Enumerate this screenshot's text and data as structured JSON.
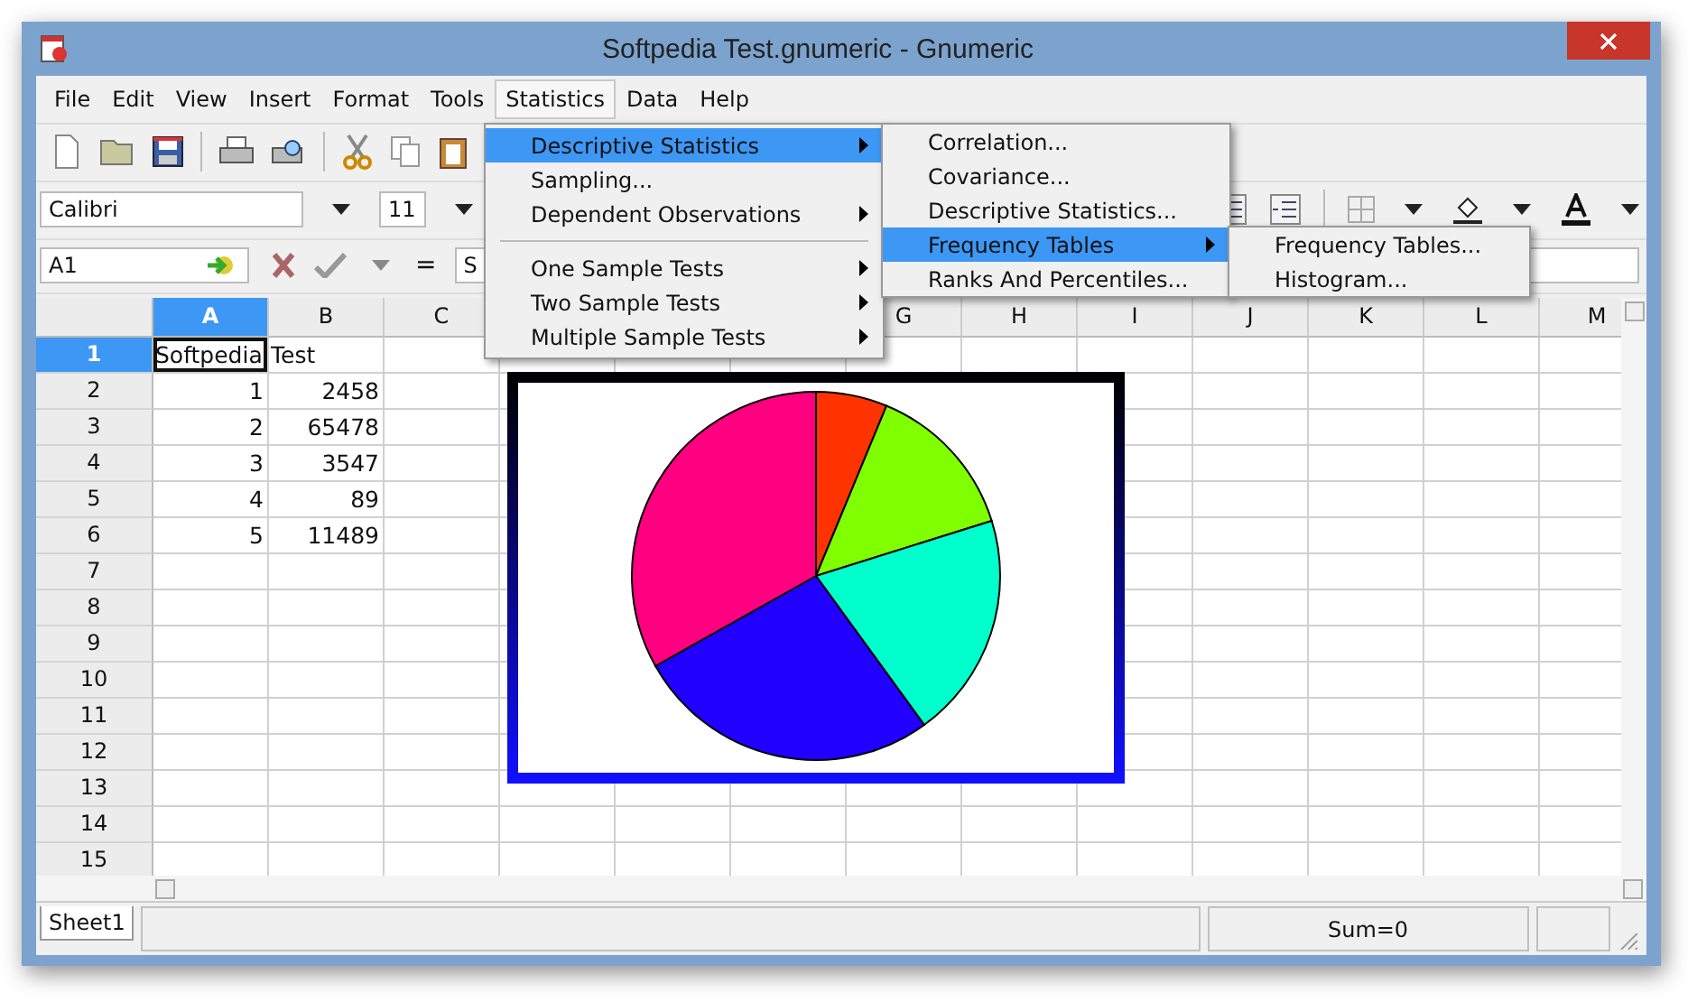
{
  "window": {
    "title": "Softpedia Test.gnumeric - Gnumeric"
  },
  "menu_bar": [
    {
      "label": "File",
      "selected": false
    },
    {
      "label": "Edit",
      "selected": false
    },
    {
      "label": "View",
      "selected": false
    },
    {
      "label": "Insert",
      "selected": false
    },
    {
      "label": "Format",
      "selected": false
    },
    {
      "label": "Tools",
      "selected": false
    },
    {
      "label": "Statistics",
      "selected": true
    },
    {
      "label": "Data",
      "selected": false
    },
    {
      "label": "Help",
      "selected": false
    }
  ],
  "format_toolbar": {
    "font": "Calibri",
    "size": "11"
  },
  "formula_bar": {
    "cell": "A1",
    "equals": "=",
    "entry": "S"
  },
  "columns_left": [
    {
      "label": "A",
      "selected": true
    },
    {
      "label": "B",
      "selected": false
    },
    {
      "label": "C",
      "selected": false
    }
  ],
  "columns_right": [
    {
      "label": "G",
      "selected": false
    },
    {
      "label": "H",
      "selected": false
    },
    {
      "label": "I",
      "selected": false
    },
    {
      "label": "J",
      "selected": false
    },
    {
      "label": "K",
      "selected": false
    },
    {
      "label": "L",
      "selected": false
    },
    {
      "label": "M",
      "selected": false
    }
  ],
  "rows": [
    {
      "label": "1",
      "selected": true,
      "cells": [
        {
          "text": "Softpedia",
          "kind": "text"
        },
        {
          "text": "Test",
          "kind": "text"
        }
      ]
    },
    {
      "label": "2",
      "selected": false,
      "cells": [
        {
          "text": "1",
          "kind": "number"
        },
        {
          "text": "2458",
          "kind": "number"
        }
      ]
    },
    {
      "label": "3",
      "selected": false,
      "cells": [
        {
          "text": "2",
          "kind": "number"
        },
        {
          "text": "65478",
          "kind": "number"
        }
      ]
    },
    {
      "label": "4",
      "selected": false,
      "cells": [
        {
          "text": "3",
          "kind": "number"
        },
        {
          "text": "3547",
          "kind": "number"
        }
      ]
    },
    {
      "label": "5",
      "selected": false,
      "cells": [
        {
          "text": "4",
          "kind": "number"
        },
        {
          "text": "89",
          "kind": "number"
        }
      ]
    },
    {
      "label": "6",
      "selected": false,
      "cells": [
        {
          "text": "5",
          "kind": "number"
        },
        {
          "text": "11489",
          "kind": "number"
        }
      ]
    },
    {
      "label": "7",
      "selected": false,
      "cells": []
    },
    {
      "label": "8",
      "selected": false,
      "cells": []
    },
    {
      "label": "9",
      "selected": false,
      "cells": []
    },
    {
      "label": "10",
      "selected": false,
      "cells": []
    },
    {
      "label": "11",
      "selected": false,
      "cells": []
    },
    {
      "label": "12",
      "selected": false,
      "cells": []
    },
    {
      "label": "13",
      "selected": false,
      "cells": []
    },
    {
      "label": "14",
      "selected": false,
      "cells": []
    },
    {
      "label": "15",
      "selected": false,
      "cells": []
    }
  ],
  "statistics_menu": [
    {
      "kind": "item",
      "label": "Descriptive Statistics",
      "has_submenu": true,
      "selected": true
    },
    {
      "kind": "item",
      "label": "Sampling...",
      "has_submenu": false,
      "selected": false
    },
    {
      "kind": "item",
      "label": "Dependent Observations",
      "has_submenu": true,
      "selected": false
    },
    {
      "kind": "separator"
    },
    {
      "kind": "item",
      "label": "One Sample Tests",
      "has_submenu": true,
      "selected": false
    },
    {
      "kind": "item",
      "label": "Two Sample Tests",
      "has_submenu": true,
      "selected": false
    },
    {
      "kind": "item",
      "label": "Multiple Sample Tests",
      "has_submenu": true,
      "selected": false
    }
  ],
  "descriptive_submenu": [
    {
      "kind": "item",
      "label": "Correlation...",
      "has_submenu": false,
      "selected": false
    },
    {
      "kind": "item",
      "label": "Covariance...",
      "has_submenu": false,
      "selected": false
    },
    {
      "kind": "item",
      "label": "Descriptive Statistics...",
      "has_submenu": false,
      "selected": false
    },
    {
      "kind": "item",
      "label": "Frequency Tables",
      "has_submenu": true,
      "selected": true
    },
    {
      "kind": "item",
      "label": "Ranks And Percentiles...",
      "has_submenu": false,
      "selected": false
    }
  ],
  "frequency_submenu": [
    {
      "kind": "item",
      "label": "Frequency Tables...",
      "has_submenu": false,
      "selected": false
    },
    {
      "kind": "item",
      "label": "Histogram...",
      "has_submenu": false,
      "selected": false
    }
  ],
  "sheet_tabs": [
    {
      "label": "Sheet1",
      "selected": true
    }
  ],
  "status_bar": {
    "sum": "Sum=0"
  }
}
